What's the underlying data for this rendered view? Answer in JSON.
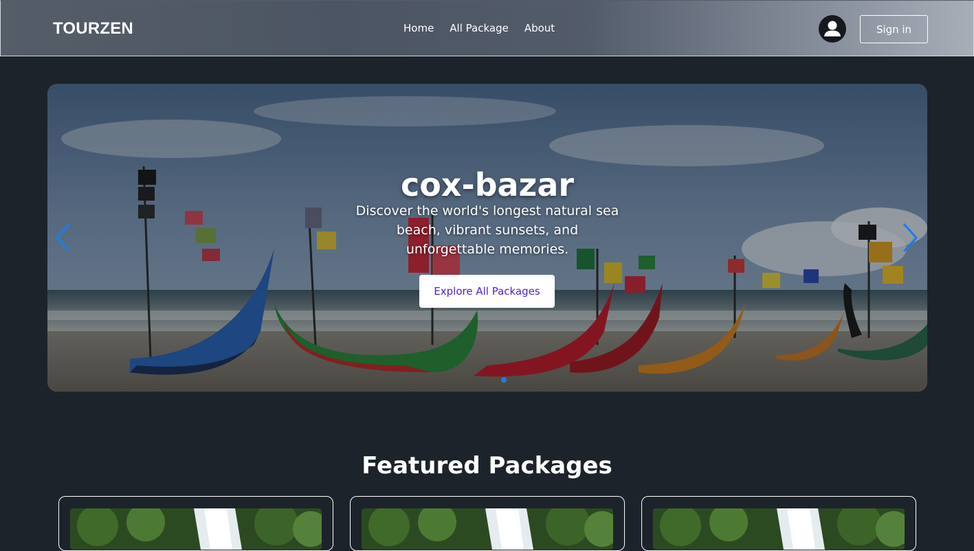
{
  "navbar": {
    "brand": "TOURZEN",
    "links": [
      "Home",
      "All Package",
      "About"
    ],
    "avatar_icon": "user-avatar-icon",
    "signin_label": "Sign in"
  },
  "hero": {
    "title": "cox-bazar",
    "description": "Discover the world's longest natural sea beach, vibrant sunsets, and unforgettable memories.",
    "cta_label": "Explore All Packages",
    "prev_icon": "chevron-left-icon",
    "next_icon": "chevron-right-icon",
    "slide_count": 1,
    "active_slide": 1
  },
  "featured": {
    "title": "Featured Packages",
    "cards": [
      {
        "image": "waterfall-forest-image"
      },
      {
        "image": "waterfall-forest-image"
      },
      {
        "image": "waterfall-forest-image"
      }
    ]
  },
  "colors": {
    "page_bg": "#1d232a",
    "accent_blue": "#1e7ce8",
    "cta_text": "#4a1fd1"
  }
}
